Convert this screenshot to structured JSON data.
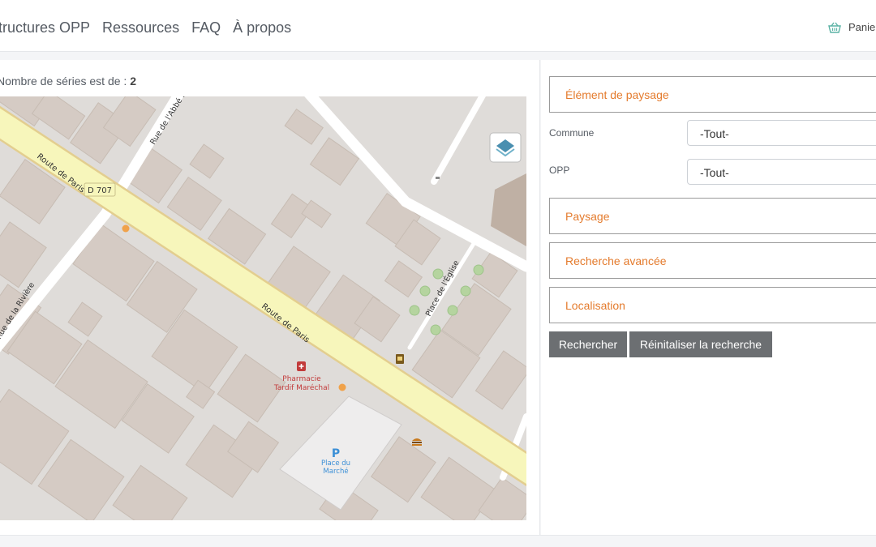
{
  "nav": {
    "items": [
      "Structures OPP",
      "Ressources",
      "FAQ",
      "À propos"
    ],
    "cart_label": "Panier"
  },
  "results": {
    "prefix": "Nombre de séries est de : ",
    "value": "2"
  },
  "map": {
    "labels": {
      "road_main_1": "Route de Paris",
      "road_main_2": "Route de Paris",
      "road_ref": "D 707",
      "road_abbe": "Rue de l'Abbé L",
      "road_riviere": "Rue de la Rivière",
      "place_eglise": "Place de l'Église",
      "pharmacy_line1": "Pharmacie",
      "pharmacy_line2": "Tardif Maréchal",
      "parking_symbol": "P",
      "parking_line1": "Place du",
      "parking_line2": "Marché"
    },
    "icons": [
      "layers-icon",
      "pharmacy-icon",
      "parking-icon",
      "fast-food-icon",
      "shop-icon"
    ]
  },
  "filters": {
    "sections": [
      "Élément de paysage",
      "Paysage",
      "Recherche avancée",
      "Localisation"
    ],
    "commune_label": "Commune",
    "commune_value": "-Tout-",
    "opp_label": "OPP",
    "opp_value": "-Tout-"
  },
  "buttons": {
    "search": "Rechercher",
    "reset": "Réinitaliser la recherche"
  },
  "colors": {
    "accent": "#e47b2d",
    "button": "#6c6f72",
    "road_main": "#f7f6bb",
    "building": "#d5cbc4",
    "map_bg": "#dfdcd9"
  }
}
